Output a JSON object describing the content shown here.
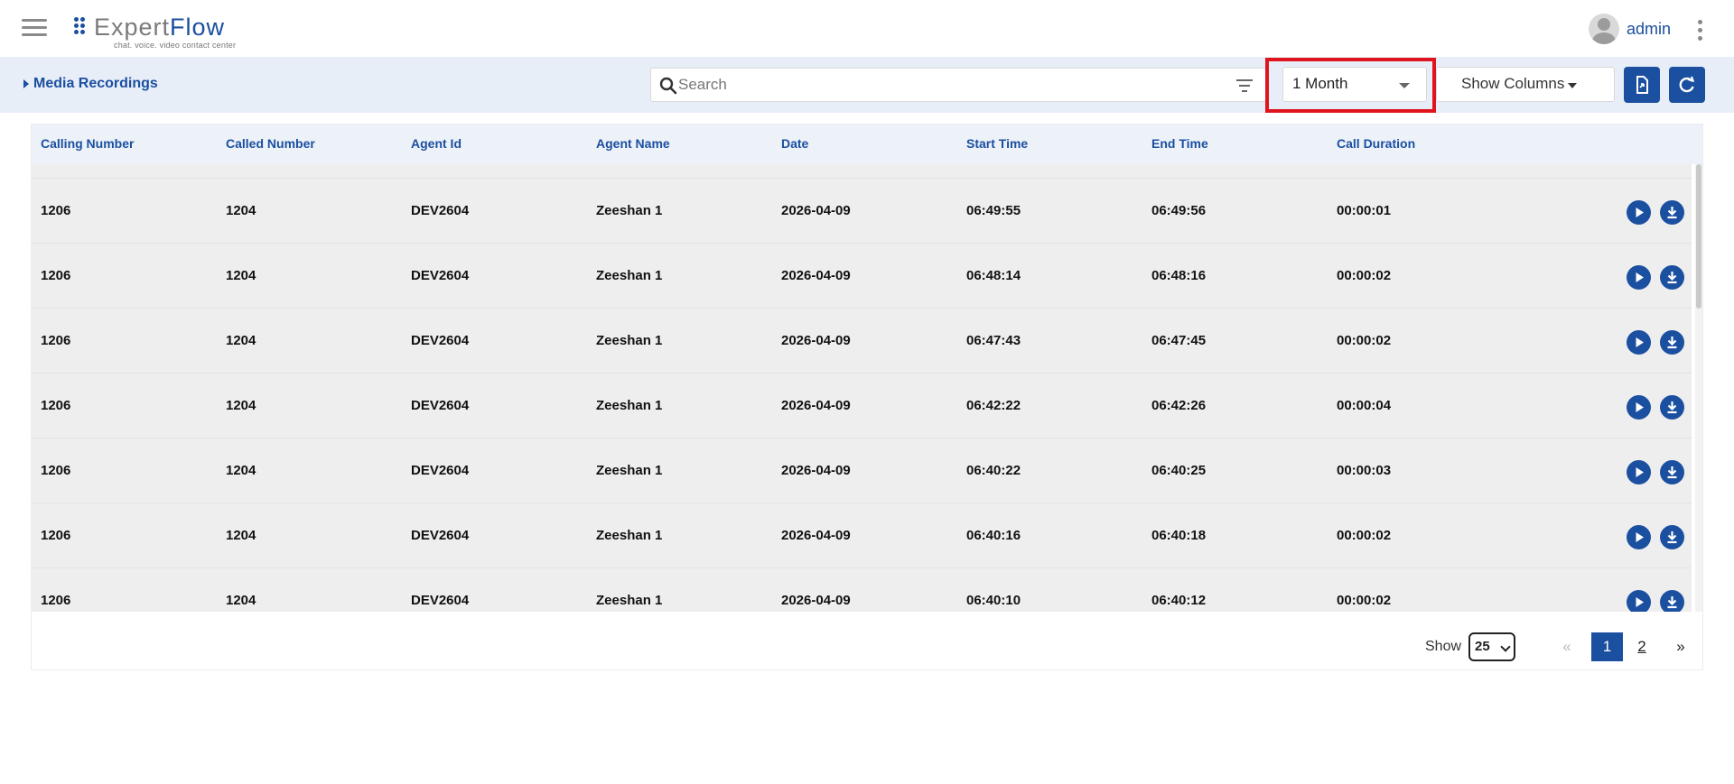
{
  "app": {
    "logo_part1": "Expert",
    "logo_part2": "Flow",
    "logo_tagline": "chat. voice. video contact center",
    "username": "admin"
  },
  "toolbar": {
    "title": "Media Recordings",
    "search_placeholder": "Search",
    "date_range": "1 Month",
    "show_columns": "Show Columns"
  },
  "table": {
    "columns": [
      "Calling Number",
      "Called Number",
      "Agent Id",
      "Agent Name",
      "Date",
      "Start Time",
      "End Time",
      "Call Duration"
    ],
    "rows": [
      [
        "1206",
        "1204",
        "DEV2604",
        "Zeeshan 1",
        "2026-04-09",
        "06:49:55",
        "06:49:56",
        "00:00:01"
      ],
      [
        "1206",
        "1204",
        "DEV2604",
        "Zeeshan 1",
        "2026-04-09",
        "06:48:14",
        "06:48:16",
        "00:00:02"
      ],
      [
        "1206",
        "1204",
        "DEV2604",
        "Zeeshan 1",
        "2026-04-09",
        "06:47:43",
        "06:47:45",
        "00:00:02"
      ],
      [
        "1206",
        "1204",
        "DEV2604",
        "Zeeshan 1",
        "2026-04-09",
        "06:42:22",
        "06:42:26",
        "00:00:04"
      ],
      [
        "1206",
        "1204",
        "DEV2604",
        "Zeeshan 1",
        "2026-04-09",
        "06:40:22",
        "06:40:25",
        "00:00:03"
      ],
      [
        "1206",
        "1204",
        "DEV2604",
        "Zeeshan 1",
        "2026-04-09",
        "06:40:16",
        "06:40:18",
        "00:00:02"
      ],
      [
        "1206",
        "1204",
        "DEV2604",
        "Zeeshan 1",
        "2026-04-09",
        "06:40:10",
        "06:40:12",
        "00:00:02"
      ]
    ],
    "row_actions": [
      "play-icon",
      "download-icon"
    ]
  },
  "pagination": {
    "show_label": "Show",
    "page_size": "25",
    "prev": "«",
    "pages": [
      "1",
      "2"
    ],
    "current_page": "1",
    "next": "»"
  },
  "colors": {
    "primary": "#1b4fa0",
    "toolbar_bg": "#e8eef7",
    "highlight": "#e0141e",
    "row_bg": "#eeeeee"
  }
}
